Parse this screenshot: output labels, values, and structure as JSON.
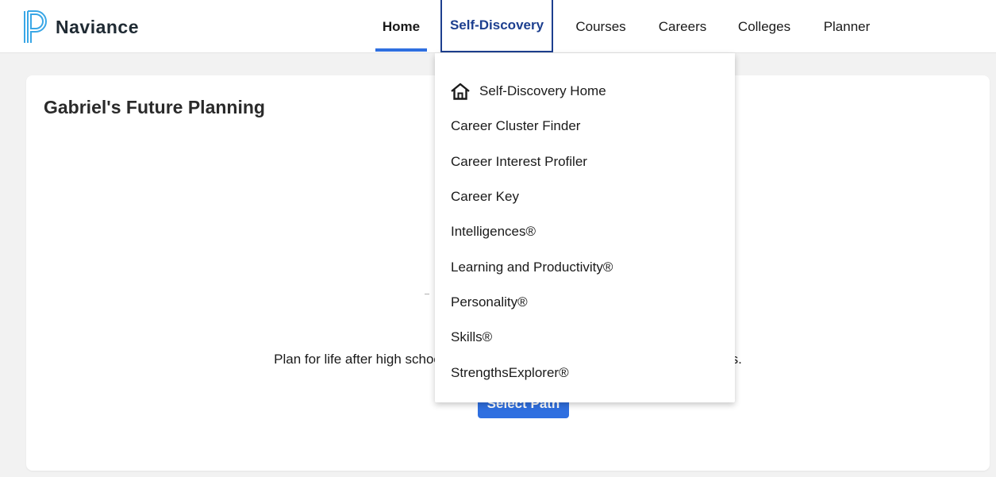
{
  "brand": {
    "name": "Naviance",
    "color": "#2f6fe0",
    "logo_icon": "naviance-logo-icon"
  },
  "nav": {
    "items": [
      {
        "label": "Home",
        "state": "current"
      },
      {
        "label": "Self-Discovery",
        "state": "open"
      },
      {
        "label": "Courses"
      },
      {
        "label": "Careers"
      },
      {
        "label": "Colleges"
      },
      {
        "label": "Planner"
      }
    ]
  },
  "card": {
    "title": "Gabriel's Future Planning",
    "description": "Plan for life after high school by selecting a path and setting goals for success.",
    "button_label": "Select Path"
  },
  "dropdown": {
    "items": [
      {
        "label": "Self-Discovery Home",
        "icon": "home-icon"
      },
      {
        "label": "Career Cluster Finder"
      },
      {
        "label": "Career Interest Profiler"
      },
      {
        "label": "Career Key"
      },
      {
        "label": "Intelligences®"
      },
      {
        "label": "Learning and Productivity®"
      },
      {
        "label": "Personality®"
      },
      {
        "label": "Skills®"
      },
      {
        "label": "StrengthsExplorer®"
      }
    ]
  },
  "colors": {
    "accent": "#2f6fe0",
    "active_outline": "#1d3f8f",
    "background": "#f2f2f2"
  }
}
